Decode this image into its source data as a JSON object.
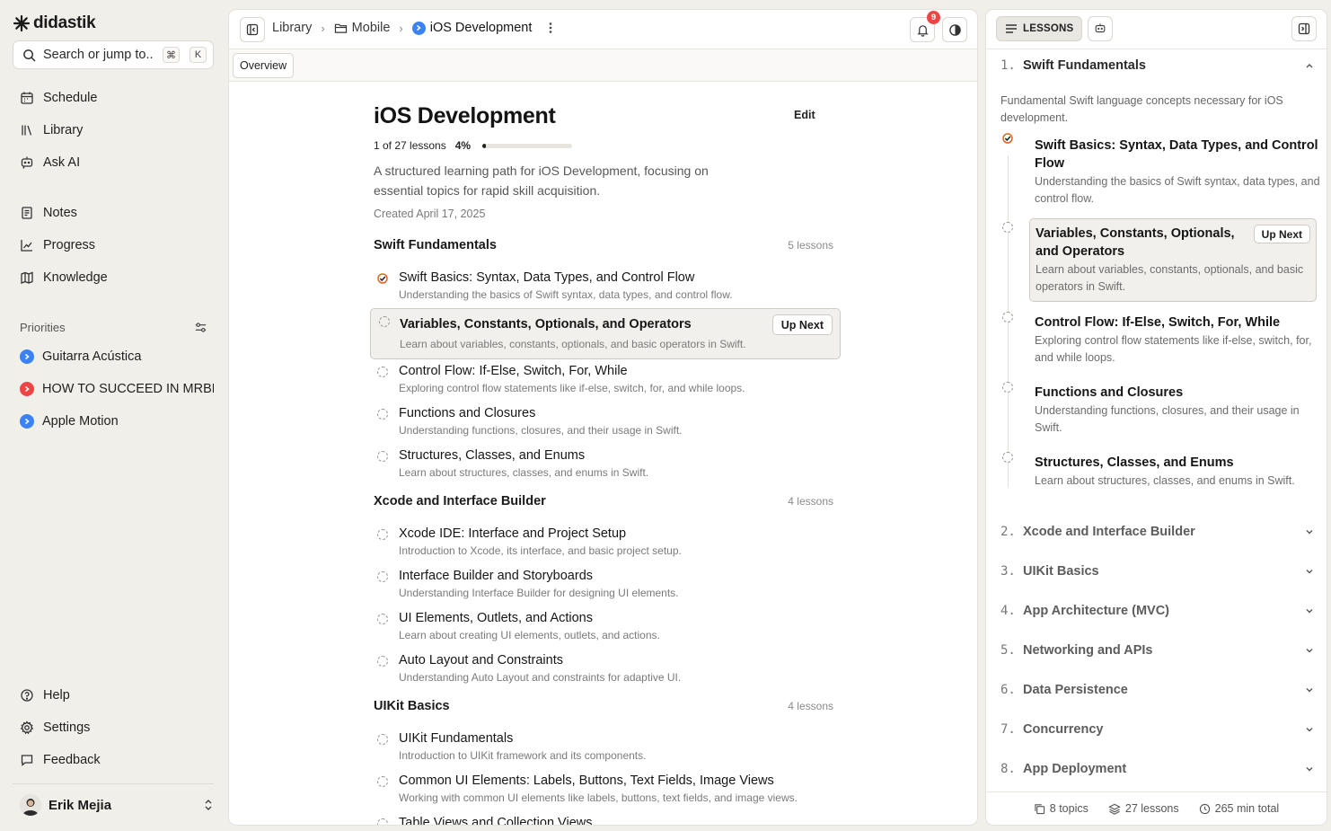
{
  "app": {
    "name": "didastik"
  },
  "search": {
    "placeholder": "Search or jump to...",
    "shortcut_mod": "⌘",
    "shortcut_key": "K"
  },
  "nav": {
    "primary": [
      {
        "label": "Schedule",
        "icon": "calendar-icon"
      },
      {
        "label": "Library",
        "icon": "library-icon"
      },
      {
        "label": "Ask AI",
        "icon": "ai-chat-icon"
      }
    ],
    "secondary": [
      {
        "label": "Notes",
        "icon": "notes-icon"
      },
      {
        "label": "Progress",
        "icon": "chart-icon"
      },
      {
        "label": "Knowledge",
        "icon": "map-icon"
      }
    ],
    "bottom": [
      {
        "label": "Help",
        "icon": "help-icon"
      },
      {
        "label": "Settings",
        "icon": "gear-icon"
      },
      {
        "label": "Feedback",
        "icon": "message-icon"
      }
    ]
  },
  "priorities": {
    "label": "Priorities",
    "items": [
      {
        "label": "Guitarra Acústica",
        "color": "#3b82f6"
      },
      {
        "label": "HOW TO SUCCEED IN MRBE...",
        "color": "#ef4444"
      },
      {
        "label": "Apple Motion",
        "color": "#3b82f6"
      }
    ]
  },
  "user": {
    "name": "Erik Mejia"
  },
  "breadcrumb": {
    "library": "Library",
    "folder": "Mobile",
    "current": "iOS Development"
  },
  "notifications": {
    "count": "9"
  },
  "tabs": {
    "overview": "Overview"
  },
  "course": {
    "title": "iOS Development",
    "edit_label": "Edit",
    "progress_text": "1 of 27 lessons",
    "progress_percent_label": "4%",
    "progress_fraction": 0.04,
    "description": "A structured learning path for iOS Development, focusing on essential topics for rapid skill acquisition.",
    "created": "Created April 17, 2025",
    "up_next_label": "Up Next"
  },
  "sections": [
    {
      "title": "Swift Fundamentals",
      "count": "5 lessons",
      "lessons": [
        {
          "title": "Swift Basics: Syntax, Data Types, and Control Flow",
          "desc": "Understanding the basics of Swift syntax, data types, and control flow.",
          "status": "done"
        },
        {
          "title": "Variables, Constants, Optionals, and Operators",
          "desc": "Learn about variables, constants, optionals, and basic operators in Swift.",
          "status": "next"
        },
        {
          "title": "Control Flow: If-Else, Switch, For, While",
          "desc": "Exploring control flow statements like if-else, switch, for, and while loops.",
          "status": "todo"
        },
        {
          "title": "Functions and Closures",
          "desc": "Understanding functions, closures, and their usage in Swift.",
          "status": "todo"
        },
        {
          "title": "Structures, Classes, and Enums",
          "desc": "Learn about structures, classes, and enums in Swift.",
          "status": "todo"
        }
      ]
    },
    {
      "title": "Xcode and Interface Builder",
      "count": "4 lessons",
      "lessons": [
        {
          "title": "Xcode IDE: Interface and Project Setup",
          "desc": "Introduction to Xcode, its interface, and basic project setup.",
          "status": "todo"
        },
        {
          "title": "Interface Builder and Storyboards",
          "desc": "Understanding Interface Builder for designing UI elements.",
          "status": "todo"
        },
        {
          "title": "UI Elements, Outlets, and Actions",
          "desc": "Learn about creating UI elements, outlets, and actions.",
          "status": "todo"
        },
        {
          "title": "Auto Layout and Constraints",
          "desc": "Understanding Auto Layout and constraints for adaptive UI.",
          "status": "todo"
        }
      ]
    },
    {
      "title": "UIKit Basics",
      "count": "4 lessons",
      "lessons": [
        {
          "title": "UIKit Fundamentals",
          "desc": "Introduction to UIKit framework and its components.",
          "status": "todo"
        },
        {
          "title": "Common UI Elements: Labels, Buttons, Text Fields, Image Views",
          "desc": "Working with common UI elements like labels, buttons, text fields, and image views.",
          "status": "todo"
        },
        {
          "title": "Table Views and Collection Views",
          "desc": "",
          "status": "todo"
        }
      ]
    }
  ],
  "right_panel": {
    "tab_label": "LESSONS",
    "open_topic": {
      "num": "1.",
      "title": "Swift Fundamentals",
      "desc": "Fundamental Swift language concepts necessary for iOS development.",
      "lessons": [
        {
          "title": "Swift Basics: Syntax, Data Types, and Control Flow",
          "desc": "Understanding the basics of Swift syntax, data types, and control flow.",
          "status": "done"
        },
        {
          "title": "Variables, Constants, Optionals, and Operators",
          "desc": "Learn about variables, constants, optionals, and basic operators in Swift.",
          "status": "next"
        },
        {
          "title": "Control Flow: If-Else, Switch, For, While",
          "desc": "Exploring control flow statements like if-else, switch, for, and while loops.",
          "status": "todo"
        },
        {
          "title": "Functions and Closures",
          "desc": "Understanding functions, closures, and their usage in Swift.",
          "status": "todo"
        },
        {
          "title": "Structures, Classes, and Enums",
          "desc": "Learn about structures, classes, and enums in Swift.",
          "status": "todo"
        }
      ]
    },
    "topics": [
      {
        "num": "2.",
        "title": "Xcode and Interface Builder"
      },
      {
        "num": "3.",
        "title": "UIKit Basics"
      },
      {
        "num": "4.",
        "title": "App Architecture (MVC)"
      },
      {
        "num": "5.",
        "title": "Networking and APIs"
      },
      {
        "num": "6.",
        "title": "Data Persistence"
      },
      {
        "num": "7.",
        "title": "Concurrency"
      },
      {
        "num": "8.",
        "title": "App Deployment"
      }
    ],
    "footer": {
      "topics": "8 topics",
      "lessons": "27 lessons",
      "duration": "265 min total"
    }
  },
  "colors": {
    "accent_done": "#e0651b",
    "priority_blue": "#3b82f6",
    "priority_red": "#ef4444",
    "badge": "#ef4444"
  }
}
